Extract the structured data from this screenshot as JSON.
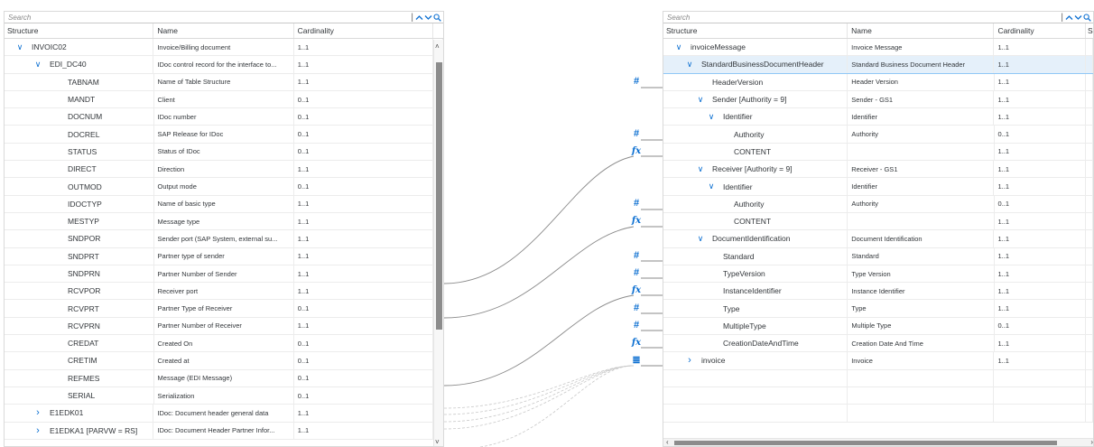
{
  "left": {
    "search_placeholder": "Search",
    "headers": {
      "structure": "Structure",
      "name": "Name",
      "cardinality": "Cardinality"
    },
    "rows": [
      {
        "level": 0,
        "expanded": true,
        "structure": "INVOIC02",
        "name": "Invoice/Billing document",
        "cardinality": "1..1"
      },
      {
        "level": 1,
        "expanded": true,
        "structure": "EDI_DC40",
        "name": "IDoc control record for the interface to...",
        "cardinality": "1..1"
      },
      {
        "level": 2,
        "structure": "TABNAM",
        "name": "Name of Table Structure",
        "cardinality": "1..1"
      },
      {
        "level": 2,
        "structure": "MANDT",
        "name": "Client",
        "cardinality": "0..1"
      },
      {
        "level": 2,
        "structure": "DOCNUM",
        "name": "IDoc number",
        "cardinality": "0..1"
      },
      {
        "level": 2,
        "structure": "DOCREL",
        "name": "SAP Release for IDoc",
        "cardinality": "0..1"
      },
      {
        "level": 2,
        "structure": "STATUS",
        "name": "Status of IDoc",
        "cardinality": "0..1"
      },
      {
        "level": 2,
        "structure": "DIRECT",
        "name": "Direction",
        "cardinality": "1..1"
      },
      {
        "level": 2,
        "structure": "OUTMOD",
        "name": "Output mode",
        "cardinality": "0..1"
      },
      {
        "level": 2,
        "structure": "IDOCTYP",
        "name": "Name of basic type",
        "cardinality": "1..1"
      },
      {
        "level": 2,
        "structure": "MESTYP",
        "name": "Message type",
        "cardinality": "1..1"
      },
      {
        "level": 2,
        "structure": "SNDPOR",
        "name": "Sender port (SAP System, external su...",
        "cardinality": "1..1"
      },
      {
        "level": 2,
        "structure": "SNDPRT",
        "name": "Partner type of sender",
        "cardinality": "1..1"
      },
      {
        "level": 2,
        "structure": "SNDPRN",
        "name": "Partner Number of Sender",
        "cardinality": "1..1"
      },
      {
        "level": 2,
        "structure": "RCVPOR",
        "name": "Receiver port",
        "cardinality": "1..1"
      },
      {
        "level": 2,
        "structure": "RCVPRT",
        "name": "Partner Type of Receiver",
        "cardinality": "0..1"
      },
      {
        "level": 2,
        "structure": "RCVPRN",
        "name": "Partner Number of Receiver",
        "cardinality": "1..1"
      },
      {
        "level": 2,
        "structure": "CREDAT",
        "name": "Created On",
        "cardinality": "0..1"
      },
      {
        "level": 2,
        "structure": "CRETIM",
        "name": "Created at",
        "cardinality": "0..1"
      },
      {
        "level": 2,
        "structure": "REFMES",
        "name": "Message (EDI Message)",
        "cardinality": "0..1"
      },
      {
        "level": 2,
        "structure": "SERIAL",
        "name": "Serialization",
        "cardinality": "0..1"
      },
      {
        "level": 1,
        "expanded": false,
        "structure": "E1EDK01",
        "name": "IDoc: Document header general data",
        "cardinality": "1..1"
      },
      {
        "level": 1,
        "expanded": false,
        "structure": "E1EDKA1 [PARVW = RS]",
        "name": "IDoc: Document Header Partner Infor...",
        "cardinality": "1..1"
      }
    ]
  },
  "right": {
    "search_placeholder": "Search",
    "headers": {
      "structure": "Structure",
      "name": "Name",
      "cardinality": "Cardinality",
      "extra": "S"
    },
    "rows": [
      {
        "level": 0,
        "expanded": true,
        "structure": "invoiceMessage",
        "name": "Invoice Message",
        "cardinality": "1..1"
      },
      {
        "level": 1,
        "expanded": true,
        "selected": true,
        "structure": "StandardBusinessDocumentHeader",
        "name": "Standard Business Document Header",
        "cardinality": "1..1"
      },
      {
        "level": 2,
        "structure": "HeaderVersion",
        "name": "Header Version",
        "cardinality": "1..1",
        "map": "hash"
      },
      {
        "level": 2,
        "expanded": true,
        "structure": "Sender [Authority = 9]",
        "name": "Sender - GS1",
        "cardinality": "1..1"
      },
      {
        "level": 3,
        "expanded": true,
        "structure": "Identifier",
        "name": "Identifier",
        "cardinality": "1..1"
      },
      {
        "level": 4,
        "structure": "Authority",
        "name": "Authority",
        "cardinality": "0..1",
        "map": "hash"
      },
      {
        "level": 4,
        "structure": "CONTENT",
        "name": "",
        "cardinality": "1..1",
        "map": "fx"
      },
      {
        "level": 2,
        "expanded": true,
        "structure": "Receiver [Authority = 9]",
        "name": "Receiver - GS1",
        "cardinality": "1..1"
      },
      {
        "level": 3,
        "expanded": true,
        "structure": "Identifier",
        "name": "Identifier",
        "cardinality": "1..1"
      },
      {
        "level": 4,
        "structure": "Authority",
        "name": "Authority",
        "cardinality": "0..1",
        "map": "hash"
      },
      {
        "level": 4,
        "structure": "CONTENT",
        "name": "",
        "cardinality": "1..1",
        "map": "fx"
      },
      {
        "level": 2,
        "expanded": true,
        "structure": "DocumentIdentification",
        "name": "Document Identification",
        "cardinality": "1..1"
      },
      {
        "level": 3,
        "structure": "Standard",
        "name": "Standard",
        "cardinality": "1..1",
        "map": "hash"
      },
      {
        "level": 3,
        "structure": "TypeVersion",
        "name": "Type Version",
        "cardinality": "1..1",
        "map": "hash"
      },
      {
        "level": 3,
        "structure": "InstanceIdentifier",
        "name": "Instance Identifier",
        "cardinality": "1..1",
        "map": "fx"
      },
      {
        "level": 3,
        "structure": "Type",
        "name": "Type",
        "cardinality": "1..1",
        "map": "hash"
      },
      {
        "level": 3,
        "structure": "MultipleType",
        "name": "Multiple Type",
        "cardinality": "0..1",
        "map": "hash"
      },
      {
        "level": 3,
        "structure": "CreationDateAndTime",
        "name": "Creation Date And Time",
        "cardinality": "1..1",
        "map": "fx"
      },
      {
        "level": 1,
        "expanded": false,
        "structure": "invoice",
        "name": "Invoice",
        "cardinality": "1..1",
        "map": "list"
      },
      {
        "level": -1,
        "structure": "",
        "name": "",
        "cardinality": ""
      },
      {
        "level": -1,
        "structure": "",
        "name": "",
        "cardinality": ""
      },
      {
        "level": -1,
        "structure": "",
        "name": "",
        "cardinality": ""
      }
    ]
  },
  "icons": {
    "hash": "#",
    "fx": "fx",
    "list": "≣",
    "search": "search-icon",
    "up": "chevron-up-icon",
    "down": "chevron-down-icon"
  },
  "colors": {
    "accent": "#0a6ed1",
    "selected_row": "#e5f0fa",
    "line": "#8a8a8a"
  }
}
